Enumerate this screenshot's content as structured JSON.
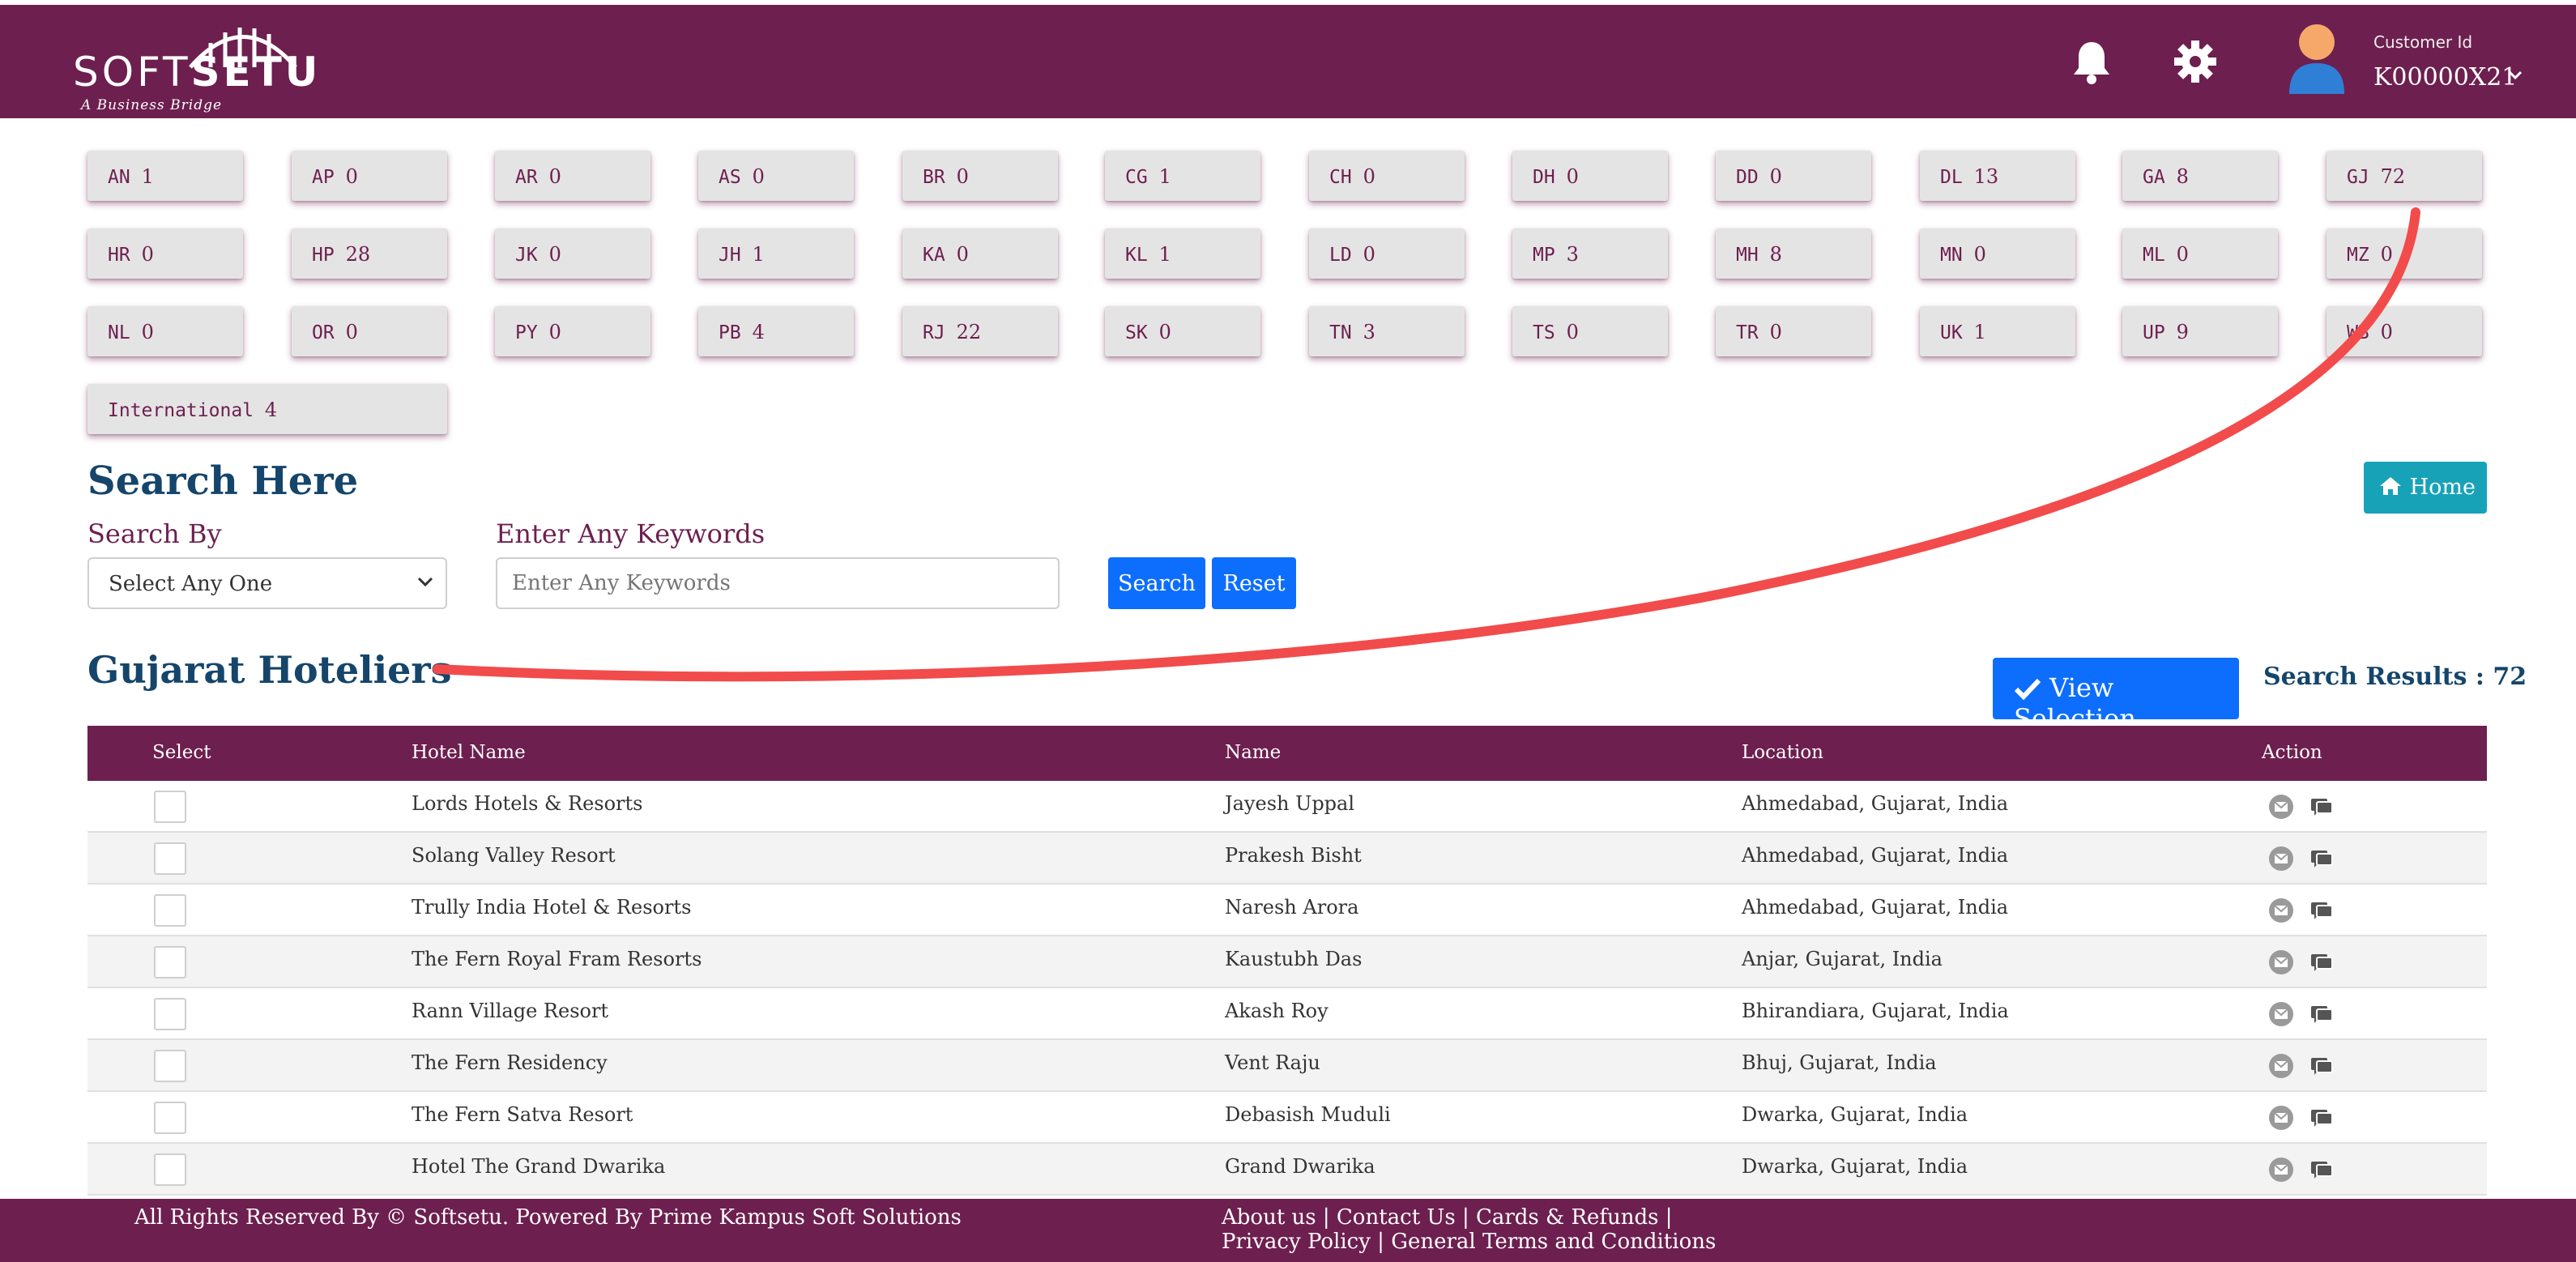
{
  "header": {
    "logo": {
      "text_light": "SOFT",
      "text_bold": "SETU",
      "tagline": "A Business Bridge"
    },
    "customer_label": "Customer Id",
    "customer_id": "K00000X21",
    "colors": {
      "brand": "#6d1f4f"
    }
  },
  "states": [
    {
      "code": "AN",
      "count": "1"
    },
    {
      "code": "AP",
      "count": "0"
    },
    {
      "code": "AR",
      "count": "0"
    },
    {
      "code": "AS",
      "count": "0"
    },
    {
      "code": "BR",
      "count": "0"
    },
    {
      "code": "CG",
      "count": "1"
    },
    {
      "code": "CH",
      "count": "0"
    },
    {
      "code": "DH",
      "count": "0"
    },
    {
      "code": "DD",
      "count": "0"
    },
    {
      "code": "DL",
      "count": "13"
    },
    {
      "code": "GA",
      "count": "8"
    },
    {
      "code": "GJ",
      "count": "72"
    },
    {
      "code": "HR",
      "count": "0"
    },
    {
      "code": "HP",
      "count": "28"
    },
    {
      "code": "JK",
      "count": "0"
    },
    {
      "code": "JH",
      "count": "1"
    },
    {
      "code": "KA",
      "count": "0"
    },
    {
      "code": "KL",
      "count": "1"
    },
    {
      "code": "LD",
      "count": "0"
    },
    {
      "code": "MP",
      "count": "3"
    },
    {
      "code": "MH",
      "count": "8"
    },
    {
      "code": "MN",
      "count": "0"
    },
    {
      "code": "ML",
      "count": "0"
    },
    {
      "code": "MZ",
      "count": "0"
    },
    {
      "code": "NL",
      "count": "0"
    },
    {
      "code": "OR",
      "count": "0"
    },
    {
      "code": "PY",
      "count": "0"
    },
    {
      "code": "PB",
      "count": "4"
    },
    {
      "code": "RJ",
      "count": "22"
    },
    {
      "code": "SK",
      "count": "0"
    },
    {
      "code": "TN",
      "count": "3"
    },
    {
      "code": "TS",
      "count": "0"
    },
    {
      "code": "TR",
      "count": "0"
    },
    {
      "code": "UK",
      "count": "1"
    },
    {
      "code": "UP",
      "count": "9"
    },
    {
      "code": "WB",
      "count": "0"
    },
    {
      "code": "International",
      "count": "4"
    }
  ],
  "search": {
    "title": "Search Here",
    "by_label": "Search By",
    "by_value": "Select Any One",
    "keywords_label": "Enter Any Keywords",
    "keywords_placeholder": "Enter Any Keywords",
    "search_btn": "Search",
    "reset_btn": "Reset",
    "home_btn": "Home"
  },
  "results": {
    "title": "Gujarat Hoteliers",
    "view_selection": "View Selection",
    "count_text": "Search Results : 72"
  },
  "table": {
    "headers": [
      "Select",
      "Hotel Name",
      "Name",
      "Location",
      "Action"
    ],
    "rows": [
      {
        "hotel": "Lords Hotels & Resorts",
        "name": "Jayesh Uppal",
        "location": "Ahmedabad, Gujarat, India"
      },
      {
        "hotel": "Solang Valley Resort",
        "name": "Prakesh Bisht",
        "location": "Ahmedabad, Gujarat, India"
      },
      {
        "hotel": "Trully India Hotel & Resorts",
        "name": "Naresh Arora",
        "location": "Ahmedabad, Gujarat, India"
      },
      {
        "hotel": "The Fern Royal Fram Resorts",
        "name": "Kaustubh Das",
        "location": "Anjar, Gujarat, India"
      },
      {
        "hotel": "Rann Village Resort",
        "name": "Akash Roy",
        "location": "Bhirandiara, Gujarat, India"
      },
      {
        "hotel": "The Fern Residency",
        "name": "Vent Raju",
        "location": "Bhuj, Gujarat, India"
      },
      {
        "hotel": "The Fern Satva Resort",
        "name": "Debasish Muduli",
        "location": "Dwarka, Gujarat, India"
      },
      {
        "hotel": "Hotel The Grand Dwarika",
        "name": "Grand Dwarika",
        "location": "Dwarka, Gujarat, India"
      }
    ]
  },
  "footer": {
    "copyright": "All Rights Reserved By © Softsetu. Powered By Prime Kampus Soft Solutions",
    "links_text": "About us | Contact Us | Cards & Refunds | Privacy Policy | General Terms and Conditions"
  }
}
